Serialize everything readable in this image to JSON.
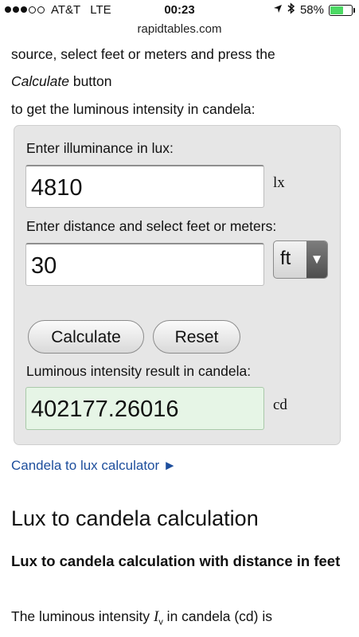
{
  "status_bar": {
    "carrier": "AT&T",
    "network": "LTE",
    "time": "00:23",
    "battery_percent": "58%",
    "battery_color": "#4cd964"
  },
  "browser": {
    "url": "rapidtables.com"
  },
  "intro": {
    "line1": "source, select feet or meters and press the",
    "line2_em": "Calculate",
    "line2_rest": " button",
    "line3": "to get the luminous intensity in candela:"
  },
  "form": {
    "illuminance_label": "Enter illuminance in lux:",
    "illuminance_value": "4810",
    "illuminance_unit": "lx",
    "distance_label": "Enter distance and select feet or meters:",
    "distance_value": "30",
    "distance_unit_selected": "ft",
    "calculate_label": "Calculate",
    "reset_label": "Reset",
    "result_label": "Luminous intensity result in candela:",
    "result_value": "402177.26016",
    "result_unit": "cd"
  },
  "link": {
    "text": "Candela to lux calculator ►",
    "color": "#1d4e9c"
  },
  "section": {
    "heading": "Lux to candela calculation",
    "subheading": "Lux to candela calculation with distance in feet",
    "para_start": "The luminous intensity ",
    "para_var": "I",
    "para_sub": "v",
    "para_end": " in candela (cd) is"
  }
}
